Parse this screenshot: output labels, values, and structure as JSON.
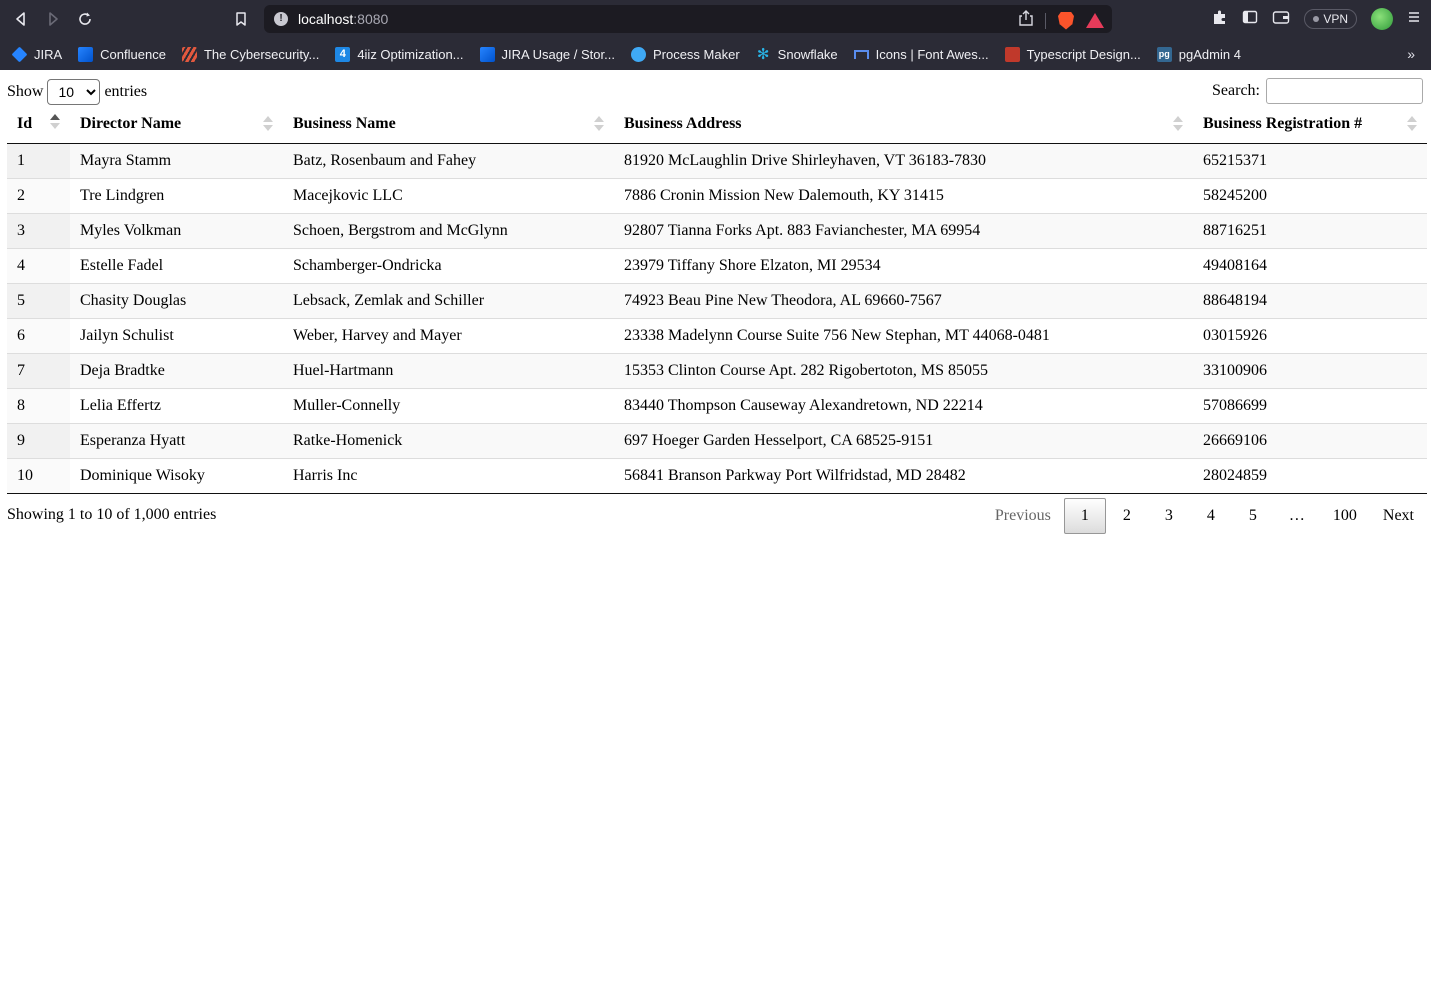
{
  "browser": {
    "url_host": "localhost",
    "url_port": ":8080",
    "vpn_label": "VPN",
    "bookmarks": [
      {
        "label": "JIRA",
        "icon": "jira-icon",
        "color": "#2684ff"
      },
      {
        "label": "Confluence",
        "icon": "confluence-icon",
        "color": "#2684ff"
      },
      {
        "label": "The Cybersecurity...",
        "icon": "cybersecurity-icon",
        "color": "#e2583e"
      },
      {
        "label": "4iiz Optimization...",
        "icon": "4iiz-icon",
        "color": "#1e88e5"
      },
      {
        "label": "JIRA Usage / Stor...",
        "icon": "jira-icon",
        "color": "#2684ff"
      },
      {
        "label": "Process Maker",
        "icon": "processmaker-icon",
        "color": "#3fa9f5"
      },
      {
        "label": "Snowflake",
        "icon": "snowflake-icon",
        "color": "#29b5e8"
      },
      {
        "label": "Icons | Font Awes...",
        "icon": "flag-icon",
        "color": "#5a8dee"
      },
      {
        "label": "Typescript Design...",
        "icon": "typescript-icon",
        "color": "#c0392b"
      },
      {
        "label": "pgAdmin 4",
        "icon": "pgadmin-icon",
        "color": "#336791"
      }
    ],
    "bookmarks_more": "»"
  },
  "controls": {
    "show_label": "Show",
    "entries_label": "entries",
    "page_length": "10",
    "page_length_options": [
      "10"
    ],
    "search_label": "Search:",
    "search_value": ""
  },
  "table": {
    "columns": [
      "Id",
      "Director Name",
      "Business Name",
      "Business Address",
      "Business Registration #"
    ],
    "sorted_column": "Id",
    "sort_direction": "ascending",
    "rows": [
      [
        "1",
        "Mayra Stamm",
        "Batz, Rosenbaum and Fahey",
        "81920 McLaughlin Drive Shirleyhaven, VT 36183-7830",
        "65215371"
      ],
      [
        "2",
        "Tre Lindgren",
        "Macejkovic LLC",
        "7886 Cronin Mission New Dalemouth, KY 31415",
        "58245200"
      ],
      [
        "3",
        "Myles Volkman",
        "Schoen, Bergstrom and McGlynn",
        "92807 Tianna Forks Apt. 883 Favianchester, MA 69954",
        "88716251"
      ],
      [
        "4",
        "Estelle Fadel",
        "Schamberger-Ondricka",
        "23979 Tiffany Shore Elzaton, MI 29534",
        "49408164"
      ],
      [
        "5",
        "Chasity Douglas",
        "Lebsack, Zemlak and Schiller",
        "74923 Beau Pine New Theodora, AL 69660-7567",
        "88648194"
      ],
      [
        "6",
        "Jailyn Schulist",
        "Weber, Harvey and Mayer",
        "23338 Madelynn Course Suite 756 New Stephan, MT 44068-0481",
        "03015926"
      ],
      [
        "7",
        "Deja Bradtke",
        "Huel-Hartmann",
        "15353 Clinton Course Apt. 282 Rigobertoton, MS 85055",
        "33100906"
      ],
      [
        "8",
        "Lelia Effertz",
        "Muller-Connelly",
        "83440 Thompson Causeway Alexandretown, ND 22214",
        "57086699"
      ],
      [
        "9",
        "Esperanza Hyatt",
        "Ratke-Homenick",
        "697 Hoeger Garden Hesselport, CA 68525-9151",
        "26669106"
      ],
      [
        "10",
        "Dominique Wisoky",
        "Harris Inc",
        "56841 Branson Parkway Port Wilfridstad, MD 28482",
        "28024859"
      ]
    ]
  },
  "footer": {
    "info": "Showing 1 to 10 of 1,000 entries",
    "previous": "Previous",
    "pages": [
      "1",
      "2",
      "3",
      "4",
      "5"
    ],
    "ellipsis": "…",
    "last_page": "100",
    "next": "Next",
    "current_page": "1"
  }
}
